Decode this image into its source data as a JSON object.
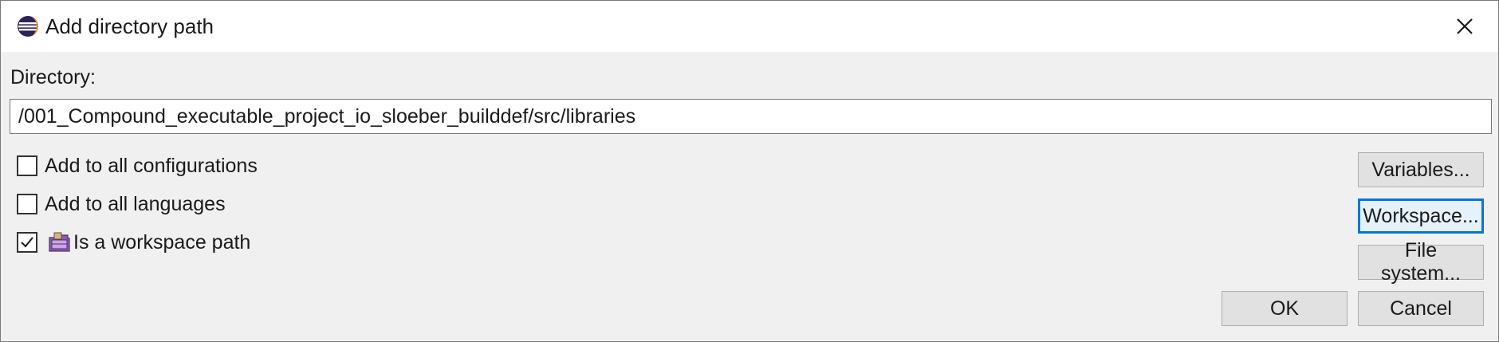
{
  "window": {
    "title": "Add directory path"
  },
  "icons": {
    "app": "eclipse-icon",
    "close": "close-icon",
    "workspace": "workspace-folder-icon"
  },
  "directory": {
    "label": "Directory:",
    "value": "/001_Compound_executable_project_io_sloeber_builddef/src/libraries"
  },
  "options": [
    {
      "label": "Add to all configurations",
      "checked": false
    },
    {
      "label": "Add to all languages",
      "checked": false
    },
    {
      "label": "Is a workspace path",
      "checked": true
    }
  ],
  "buttons": {
    "variables": "Variables...",
    "workspace": "Workspace...",
    "filesystem": "File system...",
    "ok": "OK",
    "cancel": "Cancel"
  },
  "colors": {
    "focus": "#0078d7",
    "button_bg": "#e1e1e1",
    "dialog_bg": "#f0f0f0"
  }
}
